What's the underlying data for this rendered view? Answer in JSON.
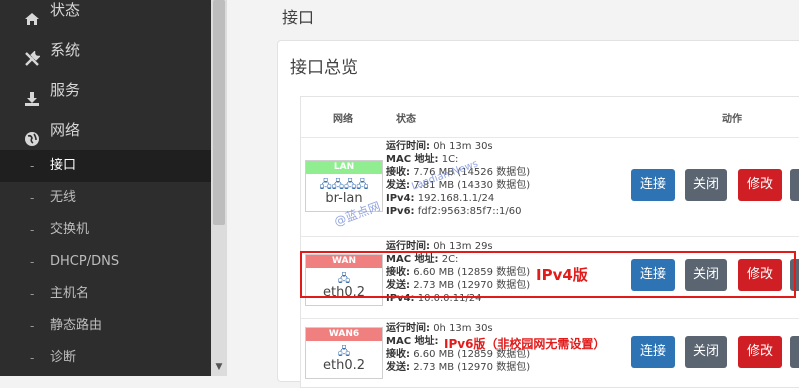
{
  "sidebar": {
    "main": [
      {
        "label": "状态",
        "icon": "home-icon"
      },
      {
        "label": "系统",
        "icon": "wrench-icon"
      },
      {
        "label": "服务",
        "icon": "download-icon"
      },
      {
        "label": "网络",
        "icon": "globe-icon"
      }
    ],
    "sub": [
      {
        "label": "接口",
        "active": true
      },
      {
        "label": "无线"
      },
      {
        "label": "交换机"
      },
      {
        "label": "DHCP/DNS"
      },
      {
        "label": "主机名"
      },
      {
        "label": "静态路由"
      },
      {
        "label": "诊断"
      }
    ]
  },
  "page": {
    "title": "接口",
    "section_title": "接口总览"
  },
  "table": {
    "headers": {
      "network": "网络",
      "status": "状态",
      "actions": "动作"
    }
  },
  "interfaces": [
    {
      "name": "LAN",
      "device": "br-lan",
      "badge_color": "#90ee90",
      "icons": "🖧🖧🖧🖧",
      "status": {
        "uptime_label": "运行时间:",
        "uptime": "0h 13m 30s",
        "mac_label": "MAC 地址:",
        "mac": "1C:",
        "rx_label": "接收:",
        "rx": "7.76 MB (14526 数据包)",
        "tx_label": "发送:",
        "tx": "7.81 MB (14330 数据包)",
        "ipv4_label": "IPv4:",
        "ipv4": "192.168.1.1/24",
        "ipv6_label": "IPv6:",
        "ipv6": "fdf2:9563:85f7::1/60"
      }
    },
    {
      "name": "WAN",
      "device": "eth0.2",
      "badge_color": "#f08080",
      "icons": "🖧",
      "status": {
        "uptime_label": "运行时间:",
        "uptime": "0h 13m 29s",
        "mac_label": "MAC 地址:",
        "mac": "2C:",
        "rx_label": "接收:",
        "rx": "6.60 MB (12859 数据包)",
        "tx_label": "发送:",
        "tx": "2.73 MB (12970 数据包)",
        "ipv4_label": "IPv4:",
        "ipv4": "10.0.0.11/24"
      }
    },
    {
      "name": "WAN6",
      "device": "eth0.2",
      "badge_color": "#f08080",
      "icons": "🖧",
      "status": {
        "uptime_label": "运行时间:",
        "uptime": "0h 13m 30s",
        "mac_label": "MAC 地址:",
        "mac": "",
        "rx_label": "接收:",
        "rx": "6.60 MB (12859 数据包)",
        "tx_label": "发送:",
        "tx": "2.73 MB (12970 数据包)"
      }
    }
  ],
  "buttons": {
    "connect": "连接",
    "close": "关闭",
    "edit": "修改"
  },
  "annotations": {
    "ipv4": "IPv4版",
    "ipv6": "IPv6版（非校园网无需设置）"
  },
  "watermarks": {
    "main": "@蓝点网",
    "secondary": "Landian.News"
  }
}
